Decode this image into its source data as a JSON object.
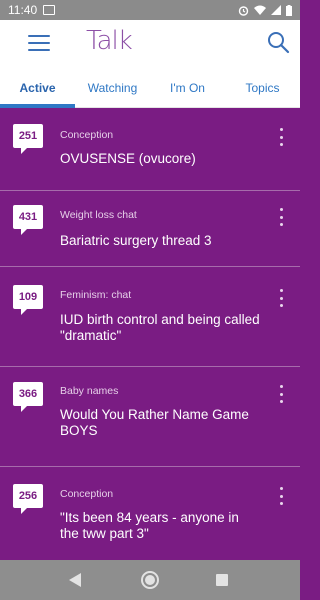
{
  "status_bar": {
    "time": "11:40"
  },
  "app_bar": {
    "logo": "Talk",
    "menu_icon": "hamburger-menu-icon",
    "search_icon": "search-icon"
  },
  "tabs": [
    {
      "label": "Active",
      "selected": true
    },
    {
      "label": "Watching",
      "selected": false
    },
    {
      "label": "I'm On",
      "selected": false
    },
    {
      "label": "Topics",
      "selected": false
    }
  ],
  "threads": [
    {
      "count": "251",
      "category": "Conception",
      "title": "OVUSENSE (ovucore)"
    },
    {
      "count": "431",
      "category": "Weight loss chat",
      "title": "Bariatric surgery thread 3"
    },
    {
      "count": "109",
      "category": "Feminism: chat",
      "title": "IUD birth control and being called \"dramatic\""
    },
    {
      "count": "366",
      "category": "Baby names",
      "title": "Would You Rather Name Game BOYS"
    },
    {
      "count": "256",
      "category": "Conception",
      "title": "\"Its been 84 years - anyone in the tww part 3\""
    }
  ],
  "colors": {
    "list_background": "#7a1c83",
    "accent_blue": "#2f78c5",
    "logo_purple": "#8c4fa6"
  }
}
